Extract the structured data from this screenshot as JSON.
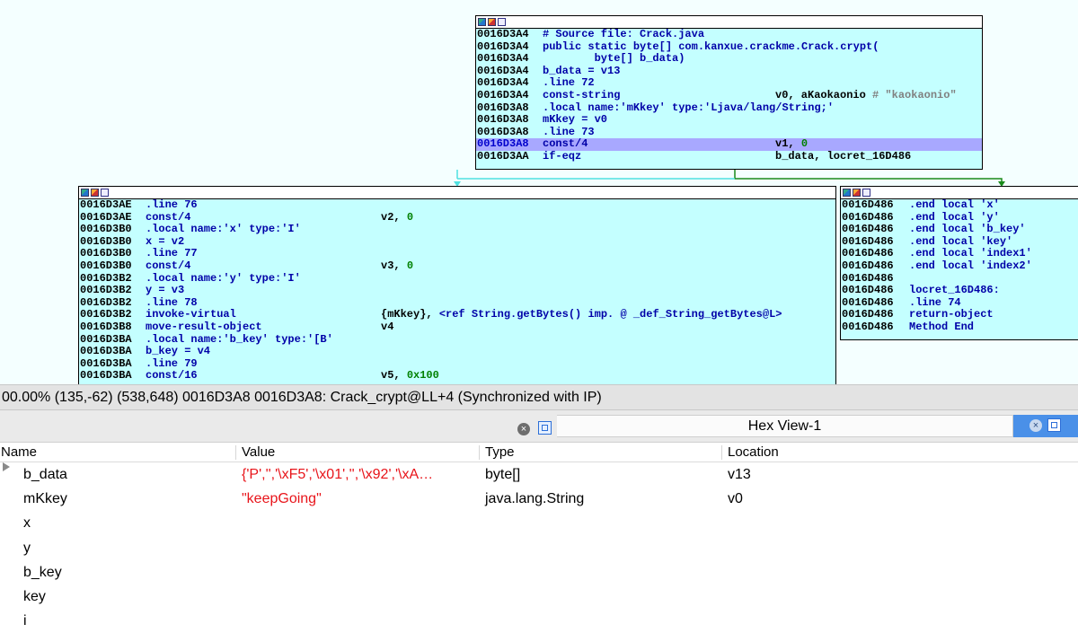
{
  "graph": {
    "top_node": [
      {
        "addr": "0016D3A4",
        "ins": "# Source file: Crack.java",
        "ops": ""
      },
      {
        "addr": "0016D3A4",
        "ins": "public static byte[] com.kanxue.crackme.Crack.crypt(",
        "ops": ""
      },
      {
        "addr": "0016D3A4",
        "ins": "        byte[] b_data)",
        "ops": ""
      },
      {
        "addr": "0016D3A4",
        "ins": "b_data = v13",
        "ops": ""
      },
      {
        "addr": "0016D3A4",
        "ins": ".line 72",
        "ops": ""
      },
      {
        "addr": "0016D3A4",
        "ins": "const-string",
        "ops": "v0, aKaokaonio",
        "ops_comment": "# \"kaokaonio\""
      },
      {
        "addr": "0016D3A8",
        "ins": ".local name:'mKkey' type:'Ljava/lang/String;'",
        "ops": ""
      },
      {
        "addr": "0016D3A8",
        "ins": "mKkey = v0",
        "ops": ""
      },
      {
        "addr": "0016D3A8",
        "ins": ".line 73",
        "ops": ""
      },
      {
        "addr": "0016D3A8",
        "ins": "const/4",
        "ops": "v1,",
        "ops_num": "0"
      },
      {
        "addr": "0016D3AA",
        "ins": "if-eqz",
        "ops": "b_data, locret_16D486"
      }
    ],
    "left_node": [
      {
        "addr": "0016D3AE",
        "ins": ".line 76",
        "ops": ""
      },
      {
        "addr": "0016D3AE",
        "ins": "const/4",
        "ops": "v2,",
        "ops_num": "0"
      },
      {
        "addr": "0016D3B0",
        "ins": ".local name:'x' type:'I'",
        "ops": ""
      },
      {
        "addr": "0016D3B0",
        "ins": "x = v2",
        "ops": ""
      },
      {
        "addr": "0016D3B0",
        "ins": ".line 77",
        "ops": ""
      },
      {
        "addr": "0016D3B0",
        "ins": "const/4",
        "ops": "v3,",
        "ops_num": "0"
      },
      {
        "addr": "0016D3B2",
        "ins": ".local name:'y' type:'I'",
        "ops": ""
      },
      {
        "addr": "0016D3B2",
        "ins": "y = v3",
        "ops": ""
      },
      {
        "addr": "0016D3B2",
        "ins": ".line 78",
        "ops": ""
      },
      {
        "addr": "0016D3B2",
        "ins": "invoke-virtual",
        "ops": "{mKkey},",
        "ops_ref": "<ref String.getBytes() imp. @ _def_String_getBytes@L>"
      },
      {
        "addr": "0016D3B8",
        "ins": "move-result-object",
        "ops": "v4"
      },
      {
        "addr": "0016D3BA",
        "ins": ".local name:'b_key' type:'[B'",
        "ops": ""
      },
      {
        "addr": "0016D3BA",
        "ins": "b_key = v4",
        "ops": ""
      },
      {
        "addr": "0016D3BA",
        "ins": ".line 79",
        "ops": ""
      },
      {
        "addr": "0016D3BA",
        "ins": "const/16",
        "ops": "v5,",
        "ops_num": "0x100"
      }
    ],
    "right_node": [
      {
        "addr": "0016D486",
        "ins": ".end local 'x'",
        "ops": ""
      },
      {
        "addr": "0016D486",
        "ins": ".end local 'y'",
        "ops": ""
      },
      {
        "addr": "0016D486",
        "ins": ".end local 'b_key'",
        "ops": ""
      },
      {
        "addr": "0016D486",
        "ins": ".end local 'key'",
        "ops": ""
      },
      {
        "addr": "0016D486",
        "ins": ".end local 'index1'",
        "ops": ""
      },
      {
        "addr": "0016D486",
        "ins": ".end local 'index2'",
        "ops": ""
      },
      {
        "addr": "0016D486",
        "ins": "",
        "ops": ""
      },
      {
        "addr": "0016D486",
        "ins": "locret_16D486:",
        "ops": ""
      },
      {
        "addr": "0016D486",
        "ins": ".line 74",
        "ops": ""
      },
      {
        "addr": "0016D486",
        "ins": "return-object",
        "ops": ""
      },
      {
        "addr": "0016D486",
        "ins": "Method End",
        "ops": ""
      }
    ]
  },
  "statusbar": {
    "text": "00.00% (135,-62) (538,648) 0016D3A8 0016D3A8: Crack_crypt@LL+4 (Synchronized with IP)"
  },
  "tabs": {
    "hex_view": "Hex View-1",
    "close_glyph": "×"
  },
  "locals": {
    "columns": [
      "Name",
      "Value",
      "Type",
      "Location"
    ],
    "rows": [
      {
        "name": "b_data",
        "value": "{'P','','\\xF5','\\x01','','\\x92','\\xA…",
        "type": "byte[]",
        "location": "v13",
        "expandable": true
      },
      {
        "name": "mKkey",
        "value": "\"keepGoing\"",
        "type": "java.lang.String",
        "location": "v0",
        "expandable": false
      },
      {
        "name": "x",
        "value": "",
        "type": "",
        "location": "",
        "expandable": false
      },
      {
        "name": "y",
        "value": "",
        "type": "",
        "location": "",
        "expandable": false
      },
      {
        "name": "b_key",
        "value": "",
        "type": "",
        "location": "",
        "expandable": false
      },
      {
        "name": "key",
        "value": "",
        "type": "",
        "location": "",
        "expandable": false
      },
      {
        "name": "i",
        "value": "",
        "type": "",
        "location": "",
        "expandable": false
      }
    ]
  },
  "colors": {
    "node_bg": "#c4ffff",
    "graph_bg": "#f4ffff",
    "highlight": "#a8a8ff",
    "instr_blue": "#0000a8",
    "value_red": "#e8141a",
    "edge_cyan": "#4fe0e0",
    "edge_green": "#1a8a1a"
  }
}
